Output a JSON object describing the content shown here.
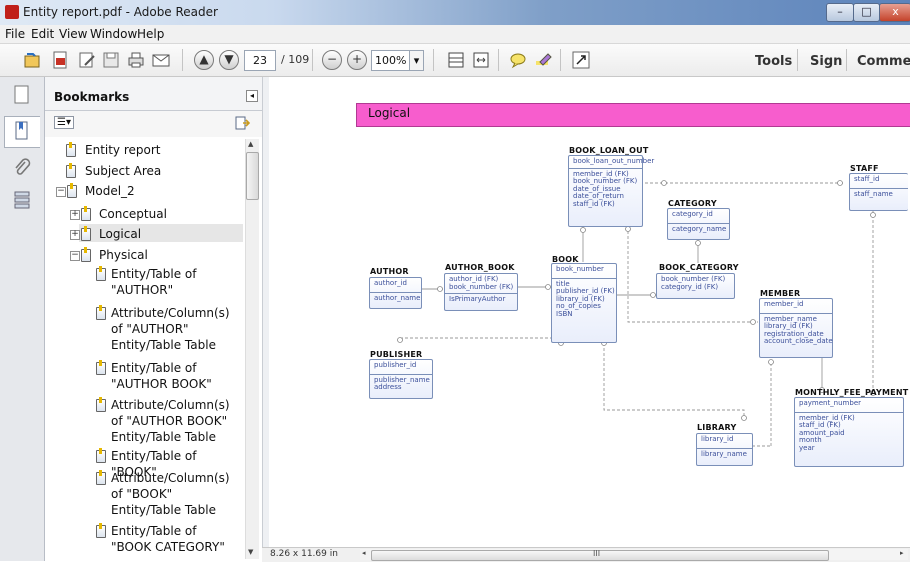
{
  "window": {
    "title": "Entity report.pdf - Adobe Reader",
    "minimize": "–",
    "maximize": "□",
    "close": "x"
  },
  "menu": [
    "File",
    "Edit",
    "View",
    "Window",
    "Help"
  ],
  "toolbar": {
    "page_current": "23",
    "page_total": "/ 109",
    "zoom": "100%",
    "zoom_dropdown": "▾",
    "right": [
      "Tools",
      "Sign",
      "Comment"
    ]
  },
  "bookmarks": {
    "title": "Bookmarks",
    "options_glyph": "☰▾",
    "items": [
      {
        "label": "Entity report"
      },
      {
        "label": "Subject Area"
      },
      {
        "label": "Model_2"
      },
      {
        "label": "Conceptual"
      },
      {
        "label": "Logical"
      },
      {
        "label": "Physical"
      },
      {
        "label": "Entity/Table of \"AUTHOR\""
      },
      {
        "label": "Attribute/Column(s) of \"AUTHOR\" Entity/Table Table"
      },
      {
        "label": "Entity/Table of \"AUTHOR BOOK\""
      },
      {
        "label": "Attribute/Column(s) of \"AUTHOR BOOK\" Entity/Table Table"
      },
      {
        "label": "Entity/Table of \"BOOK\""
      },
      {
        "label": "Attribute/Column(s) of \"BOOK\" Entity/Table Table"
      },
      {
        "label": "Entity/Table of \"BOOK CATEGORY\""
      }
    ]
  },
  "document": {
    "section_title": "Logical",
    "page_size": "8.26 x 11.69 in",
    "scroll_grip": "III",
    "entities": {
      "book_loan_out": {
        "name": "BOOK_LOAN_OUT",
        "key": [
          "book_loan_out_number"
        ],
        "attrs": [
          "member_id (FK)",
          "book_number (FK)",
          "date_of_issue",
          "date_of_return",
          "staff_id (FK)"
        ]
      },
      "staff": {
        "name": "STAFF",
        "key": [
          "staff_id"
        ],
        "attrs": [
          "staff_name"
        ]
      },
      "category": {
        "name": "CATEGORY",
        "key": [
          "category_id"
        ],
        "attrs": [
          "category_name"
        ]
      },
      "author": {
        "name": "AUTHOR",
        "key": [
          "author_id"
        ],
        "attrs": [
          "author_name"
        ]
      },
      "author_book": {
        "name": "AUTHOR_BOOK",
        "key": [
          "author_id (FK)",
          "book_number (FK)"
        ],
        "attrs": [
          "IsPrimaryAuthor"
        ]
      },
      "book": {
        "name": "BOOK",
        "key": [
          "book_number"
        ],
        "attrs": [
          "title",
          "publisher_id (FK)",
          "library_id (FK)",
          "no_of_copies",
          "ISBN"
        ]
      },
      "book_category": {
        "name": "BOOK_CATEGORY",
        "key": [
          "book_number (FK)",
          "category_id (FK)"
        ],
        "attrs": []
      },
      "member": {
        "name": "MEMBER",
        "key": [
          "member_id"
        ],
        "attrs": [
          "member_name",
          "library_id (FK)",
          "registration_date",
          "account_close_date"
        ]
      },
      "publisher": {
        "name": "PUBLISHER",
        "key": [
          "publisher_id"
        ],
        "attrs": [
          "publisher_name",
          "address"
        ]
      },
      "monthly_fee_payment": {
        "name": "MONTHLY_FEE_PAYMENT",
        "key": [
          "payment_number"
        ],
        "attrs": [
          "member_id (FK)",
          "staff_id (FK)",
          "amount_paid",
          "month",
          "year"
        ]
      },
      "library": {
        "name": "LIBRARY",
        "key": [
          "library_id"
        ],
        "attrs": [
          "library_name"
        ]
      }
    }
  },
  "colors": {
    "banner": "#f75dcd",
    "entity_text": "#3b4f9a",
    "entity_border": "#7a8fb8"
  }
}
